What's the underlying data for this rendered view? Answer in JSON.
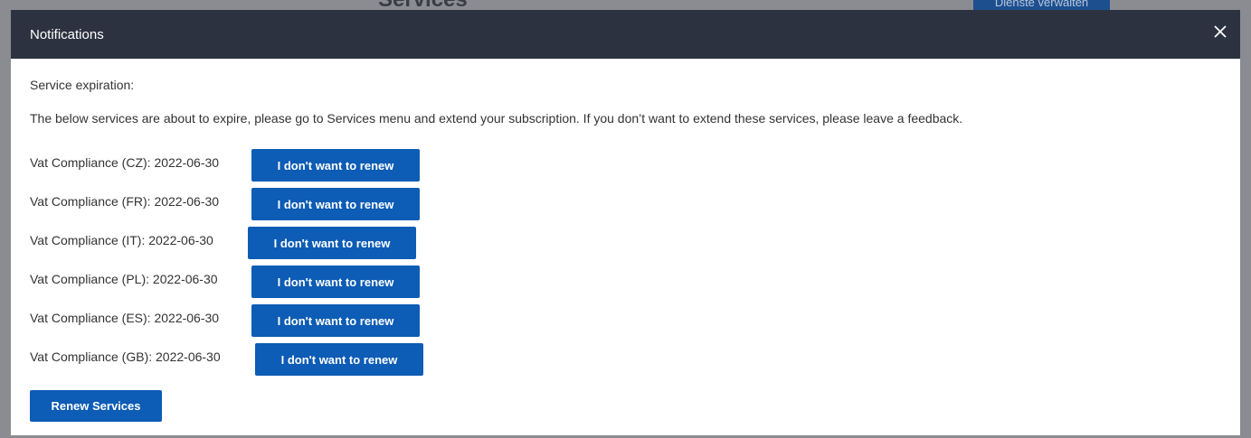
{
  "background": {
    "title": "Services",
    "button_label": "Dienste verwalten"
  },
  "modal": {
    "title": "Notifications",
    "close_icon": "close-icon",
    "heading": "Service expiration:",
    "message": "The below services are about to expire, please go to Services menu and extend your subscription. If you don’t want to extend these services, please leave a feedback.",
    "services": [
      {
        "label": "Vat Compliance (CZ): 2022-06-30",
        "button": "I don't want to renew"
      },
      {
        "label": "Vat Compliance (FR): 2022-06-30",
        "button": "I don't want to renew"
      },
      {
        "label": "Vat Compliance (IT): 2022-06-30",
        "button": "I don't want to renew"
      },
      {
        "label": "Vat Compliance (PL): 2022-06-30",
        "button": "I don't want to renew"
      },
      {
        "label": "Vat Compliance (ES): 2022-06-30",
        "button": "I don't want to renew"
      },
      {
        "label": "Vat Compliance (GB): 2022-06-30",
        "button": "I don't want to renew"
      }
    ],
    "renew_button": "Renew Services"
  },
  "colors": {
    "header_bg": "#2c323f",
    "button_bg": "#0d5cb5",
    "text": "#333333"
  }
}
